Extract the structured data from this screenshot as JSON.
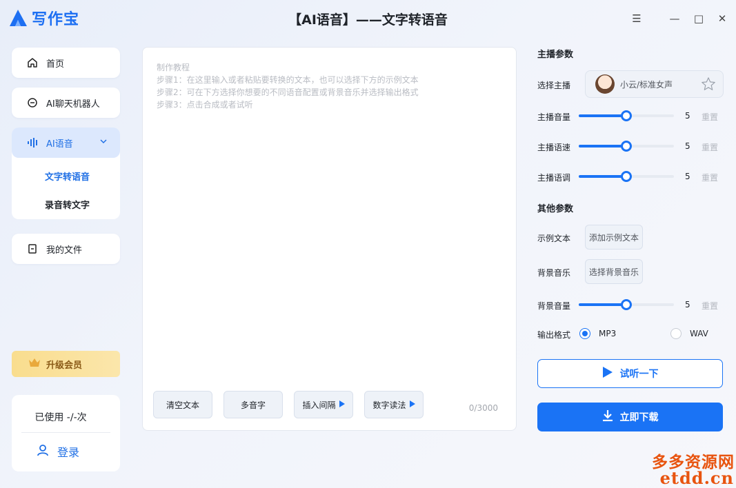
{
  "app": {
    "logo_text": "写作宝",
    "page_title": "【AI语音】——文字转语音"
  },
  "window_controls": {
    "menu": "☰",
    "minimize": "—",
    "maximize": "□",
    "close": "✕"
  },
  "sidebar": {
    "home": "首页",
    "chatbot": "AI聊天机器人",
    "ai_voice": "AI语音",
    "sub_items": [
      "文字转语音",
      "录音转文字"
    ],
    "files": "我的文件",
    "upgrade": "升级会员",
    "usage": "已使用 -/-次",
    "login": "登录"
  },
  "editor": {
    "hint_lines": [
      "制作教程",
      "步骤1：在这里输入或者粘贴要转换的文本，也可以选择下方的示例文本",
      "步骤2：可在下方选择你想要的不同语音配置或背景音乐并选择输出格式",
      "步骤3：点击合成或者试听"
    ],
    "buttons": {
      "clear": "清空文本",
      "polyphone": "多音字",
      "insert_pause": "插入间隔",
      "number_read": "数字读法"
    },
    "counter": "0/3000"
  },
  "panel": {
    "anchor_section": "主播参数",
    "select_anchor_label": "选择主播",
    "anchor_name": "小云/标准女声",
    "volume_label": "主播音量",
    "volume": 5,
    "speed_label": "主播语速",
    "speed": 5,
    "pitch_label": "主播语调",
    "pitch": 5,
    "slider_max": 10,
    "reset": "重置",
    "other_section": "其他参数",
    "sample_text_label": "示例文本",
    "sample_text_button": "添加示例文本",
    "bgm_label": "背景音乐",
    "bgm_button": "选择背景音乐",
    "bgm_volume_label": "背景音量",
    "bgm_volume": 5,
    "format_label": "输出格式",
    "formats": [
      "MP3",
      "WAV"
    ],
    "selected_format": "MP3",
    "listen": "试听一下",
    "download": "立即下载"
  },
  "watermark": {
    "cn": "多多资源网",
    "en": "etdd.cn"
  },
  "colors": {
    "accent": "#1a73f5",
    "active_nav_bg": "#dce8fd",
    "upgrade_bg": "#f9dd8e",
    "watermark": "#e8540f"
  }
}
